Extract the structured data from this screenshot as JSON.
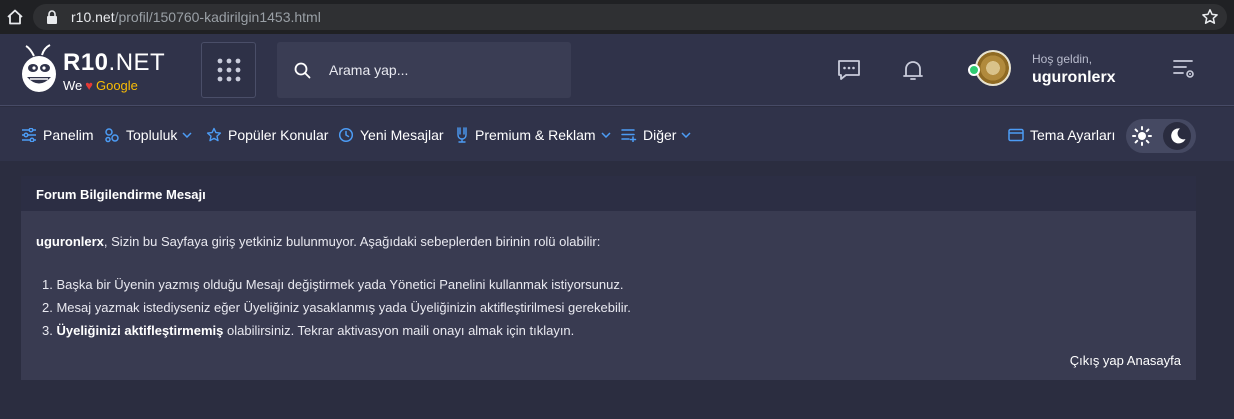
{
  "browser": {
    "url_host": "r10.net",
    "url_path": "/profil/150760-kadirilgin1453.html"
  },
  "header": {
    "logo_title_bold": "R10",
    "logo_title_rest": ".NET",
    "logo_tag_we": "We",
    "logo_tag_google": "Google",
    "search_placeholder": "Arama yap...",
    "welcome": "Hoş geldin,",
    "username": "uguronlerx"
  },
  "nav": {
    "items": [
      {
        "label": "Panelim",
        "icon": "sliders-icon",
        "dropdown": false
      },
      {
        "label": "Topluluk",
        "icon": "community-icon",
        "dropdown": true
      },
      {
        "label": "Popüler Konular",
        "icon": "star-outline-icon",
        "dropdown": false
      },
      {
        "label": "Yeni Mesajlar",
        "icon": "clock-icon",
        "dropdown": false
      },
      {
        "label": "Premium & Reklam",
        "icon": "trophy-icon",
        "dropdown": true
      },
      {
        "label": "Diğer",
        "icon": "list-plus-icon",
        "dropdown": true
      }
    ],
    "theme_settings": "Tema Ayarları",
    "theme_mode": "dark"
  },
  "message": {
    "title": "Forum Bilgilendirme Mesajı",
    "intro_user": "uguronlerx",
    "intro_text": ", Sizin bu Sayfaya giriş yetkiniz bulunmuyor. Aşağıdaki sebeplerden birinin rolü olabilir:",
    "reasons": [
      {
        "num": "1.",
        "bold": "",
        "text": "Başka bir Üyenin yazmış olduğu Mesajı değiştirmek yada Yönetici Panelini kullanmak istiyorsunuz."
      },
      {
        "num": "2.",
        "bold": "",
        "text": "Mesaj yazmak istediyseniz eğer Üyeliğiniz yasaklanmış yada Üyeliğinizin aktifleştirilmesi gerekebilir."
      },
      {
        "num": "3.",
        "bold": "Üyeliğinizi aktifleştirmemiş",
        "text": " olabilirsiniz. Tekrar aktivasyon maili onayı almak için tıklayın."
      }
    ],
    "logout": "Çıkış yap",
    "home": "Anasayfa"
  },
  "colors": {
    "page_bg": "#2b2d40",
    "header_bg": "#30334a",
    "panel_bg": "#393b51",
    "panel_head_bg": "#2c2e44",
    "icon_accent": "#4c9cf5",
    "online": "#2ecc71"
  }
}
